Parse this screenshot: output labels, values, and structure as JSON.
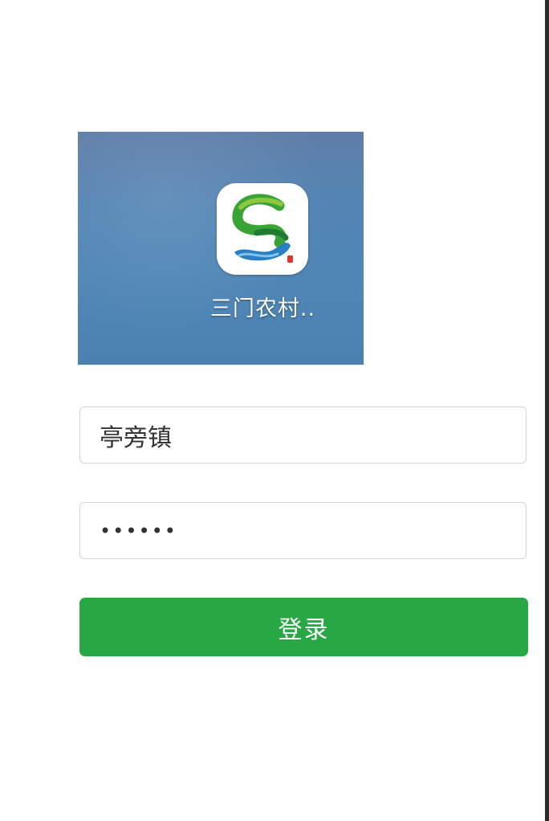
{
  "app": {
    "name": "三门农村..",
    "icon": "sanmen-app-logo-icon"
  },
  "form": {
    "username": {
      "value": "亭旁镇",
      "type": "text"
    },
    "password": {
      "value": "••••••",
      "type": "password"
    },
    "login_label": "登录"
  },
  "colors": {
    "login_button": "#28a745",
    "panel_background": "#5384b4",
    "logo_green": "#3aa335",
    "logo_blue": "#2a7fc4"
  }
}
